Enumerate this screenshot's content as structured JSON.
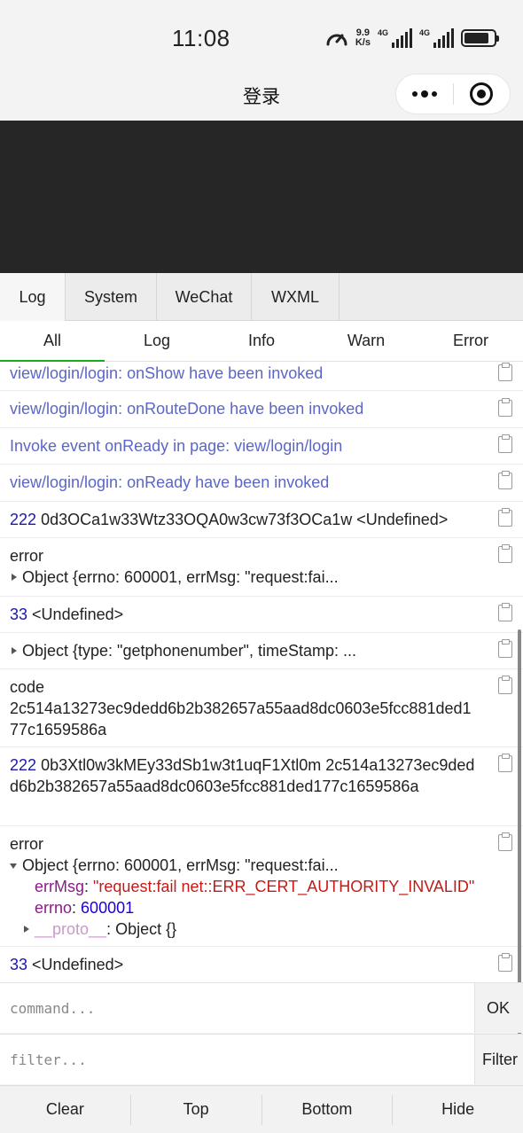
{
  "status_bar": {
    "time": "11:08",
    "net_speed_value": "9.9",
    "net_speed_unit": "K/s",
    "sig1_label": "4G",
    "sig2_label": "4G",
    "battery_level": 0.85
  },
  "nav": {
    "title": "登录"
  },
  "console": {
    "tabs": [
      "Log",
      "System",
      "WeChat",
      "WXML"
    ],
    "filters": [
      "All",
      "Log",
      "Info",
      "Warn",
      "Error"
    ],
    "entries": {
      "e1": "view/login/login: onShow have been invoked",
      "e2": "view/login/login: onRouteDone have been invoked",
      "e3": "Invoke event onReady in page: view/login/login",
      "e4": "view/login/login: onReady have been invoked",
      "e5_num": "222",
      "e5_text": "0d3OCa1w33Wtz33OQA0w3cw73f3OCa1w <Undefined>",
      "e6_head": "error",
      "e6_obj": "Object {errno: 600001, errMsg: \"request:fai...",
      "e7_num": "33",
      "e7_text": "<Undefined>",
      "e8_obj": "Object {type: \"getphonenumber\", timeStamp: ...",
      "e9_head": "code",
      "e9_text": "2c514a13273ec9dedd6b2b382657a55aad8dc0603e5fcc881ded177c1659586a",
      "e10_num": "222",
      "e10_text": "0b3Xtl0w3kMEy33dSb1w3t1uqF1Xtl0m 2c514a13273ec9dedd6b2b382657a55aad8dc0603e5fcc881ded177c1659586a",
      "e11_head": "error",
      "e11_obj": "Object {errno: 600001, errMsg: \"request:fai...",
      "e11_k1": "errMsg",
      "e11_v1": "\"request:fail net::ERR_CERT_AUTHORITY_INVALID\"",
      "e11_k2": "errno",
      "e11_v2": "600001",
      "e11_k3": "__proto__",
      "e11_v3": "Object {}",
      "e12_num": "33",
      "e12_text": "<Undefined>"
    },
    "command_placeholder": "command...",
    "ok_label": "OK",
    "filter_placeholder": "filter...",
    "filter_label": "Filter"
  },
  "toolbar": {
    "clear": "Clear",
    "top": "Top",
    "bottom": "Bottom",
    "hide": "Hide"
  }
}
